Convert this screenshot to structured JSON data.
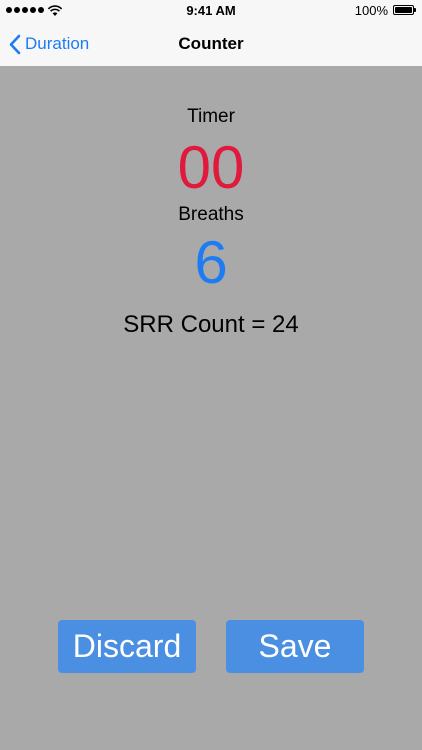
{
  "status_bar": {
    "time": "9:41 AM",
    "battery": "100%"
  },
  "nav": {
    "back_label": "Duration",
    "title": "Counter"
  },
  "main": {
    "timer_label": "Timer",
    "timer_value": "00",
    "breaths_label": "Breaths",
    "breaths_value": "6",
    "srr_count": "SRR Count = 24"
  },
  "buttons": {
    "discard": "Discard",
    "save": "Save"
  },
  "colors": {
    "accent": "#1e7cf2",
    "timer": "#e0193d",
    "button": "#4a8fe2",
    "background": "#a9a9a9"
  }
}
